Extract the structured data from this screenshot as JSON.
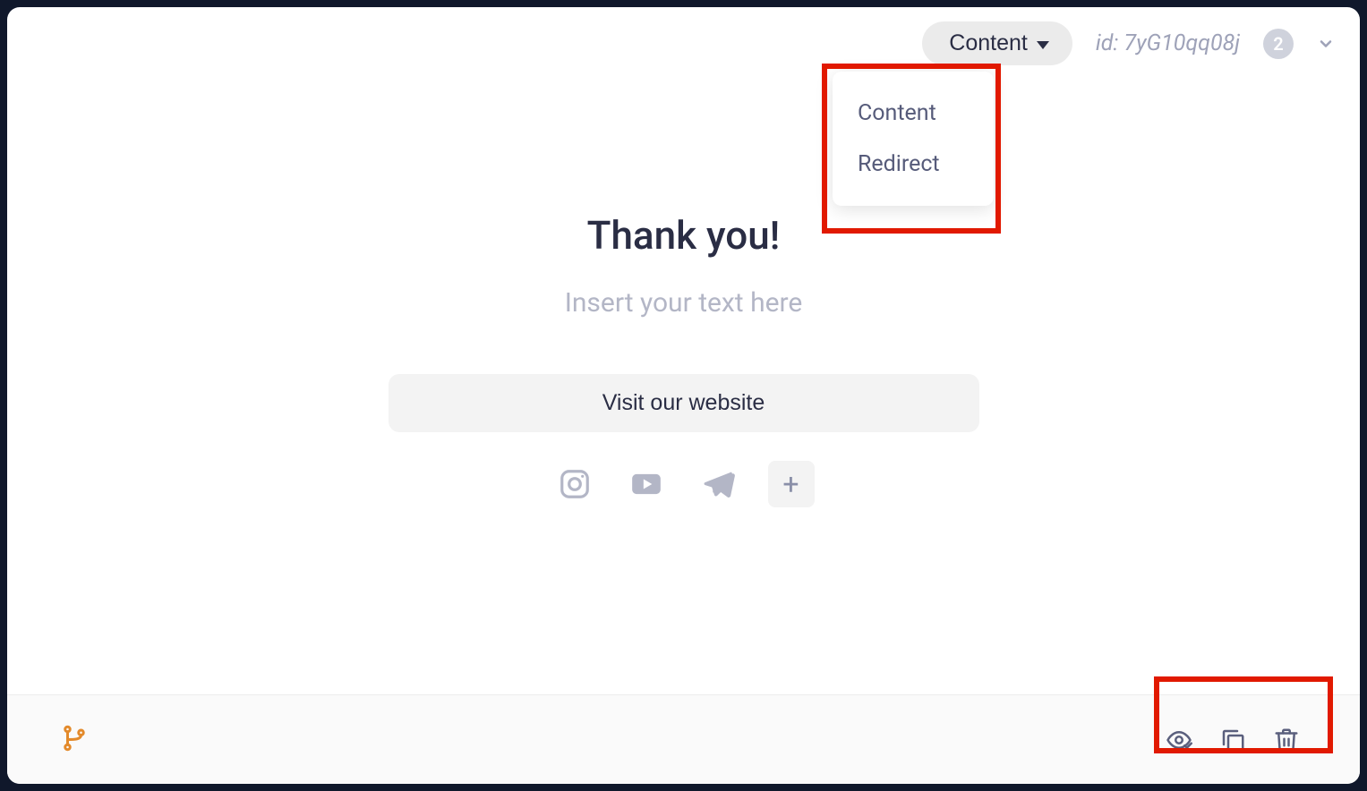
{
  "header": {
    "dropdown_label": "Content",
    "id_text": "id: 7yG10qq08j",
    "count": "2",
    "menu": {
      "item0": "Content",
      "item1": "Redirect"
    }
  },
  "content": {
    "title": "Thank you!",
    "subtitle": "Insert your text here",
    "cta": "Visit our website",
    "add_social": "+"
  }
}
